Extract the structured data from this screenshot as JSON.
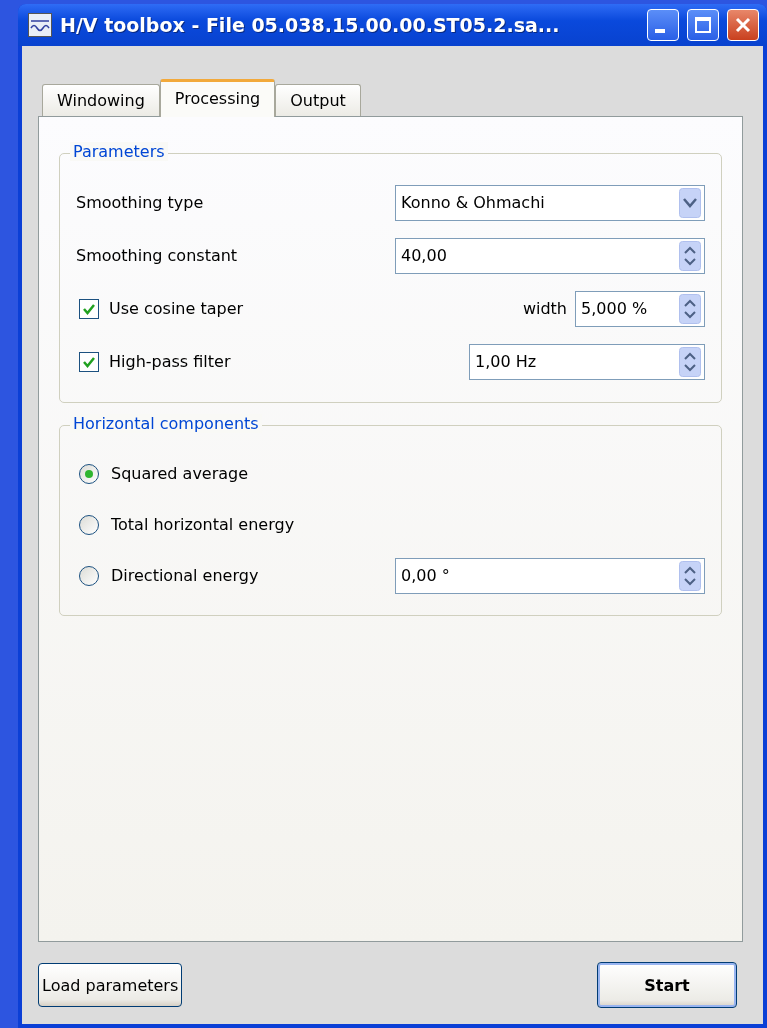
{
  "window": {
    "title": "H/V toolbox - File 05.038.15.00.00.ST05.2.sa..."
  },
  "tabs": [
    {
      "label": "Windowing",
      "selected": false
    },
    {
      "label": "Processing",
      "selected": true
    },
    {
      "label": "Output",
      "selected": false
    }
  ],
  "parameters": {
    "title": "Parameters",
    "rows": [
      {
        "kind": "combo",
        "label": "Smoothing type",
        "value": "Konno & Ohmachi"
      },
      {
        "kind": "spin",
        "label": "Smoothing constant",
        "value": "40,00"
      },
      {
        "kind": "check",
        "label": "Use cosine taper",
        "checked": true,
        "side_label": "width",
        "value": "5,000 %"
      },
      {
        "kind": "check",
        "label": "High-pass filter",
        "checked": true,
        "value": "1,00 Hz"
      }
    ]
  },
  "horizontal_components": {
    "title": "Horizontal components",
    "options": [
      {
        "label": "Squared average",
        "selected": true
      },
      {
        "label": "Total horizontal energy",
        "selected": false
      },
      {
        "label": "Directional energy",
        "selected": false,
        "value": "0,00 °"
      }
    ]
  },
  "buttons": [
    {
      "label": "Load parameters",
      "default": false
    },
    {
      "label": "Start",
      "default": true
    }
  ]
}
